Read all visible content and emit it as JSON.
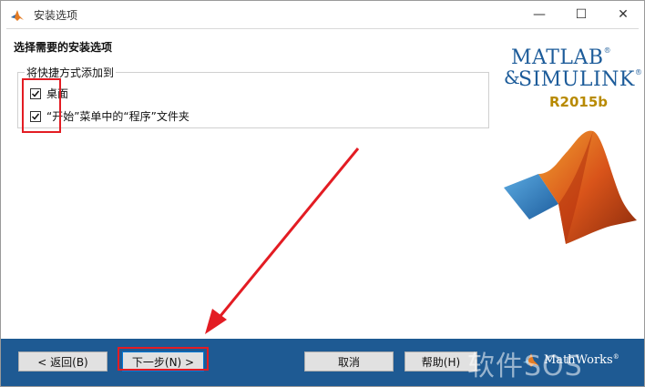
{
  "window": {
    "title": "安装选项"
  },
  "controls": {
    "minimize": "—",
    "maximize": "☐",
    "close": "✕"
  },
  "page": {
    "heading": "选择需要的安装选项"
  },
  "group": {
    "legend": "将快捷方式添加到",
    "options": [
      {
        "label": "桌面",
        "checked": true
      },
      {
        "label": "“开始”菜单中的“程序”文件夹",
        "checked": true
      }
    ]
  },
  "logo": {
    "line1": "MATLAB",
    "line2": "SIMULINK",
    "amp": "&",
    "reg": "®",
    "release": "R2015b"
  },
  "buttons": {
    "back": "< 返回(B)",
    "next": "下一步(N) >",
    "cancel": "取消",
    "help": "帮助(H)"
  },
  "footer": {
    "mathworks": "MathWorks",
    "mathworks_reg": "®",
    "watermark": "软件SOS"
  },
  "colors": {
    "footer_bg": "#1e5a93",
    "annotation_red": "#e31c23",
    "logo_blue": "#1d5c9a"
  }
}
